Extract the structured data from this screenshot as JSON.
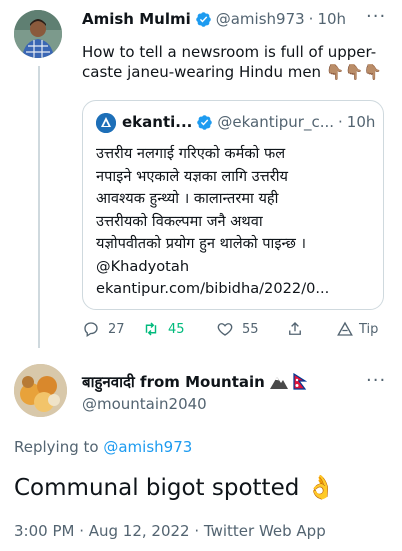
{
  "tweet": {
    "display_name": "Amish Mulmi",
    "handle": "@amish973",
    "time": "10h",
    "more": "···",
    "text_line1": "How to tell a newsroom is full of upper-",
    "text_line2": "caste janeu-wearing Hindu men",
    "emoji": "👇🏽👇🏽👇🏽",
    "quote": {
      "name": "ekanti...",
      "handle": "@ekantipur_c...",
      "time": "10h",
      "lines": [
        "उत्तरीय नलगाई गरिएको कर्मको फल",
        "नपाइने भएकाले यज्ञका लागि उत्तरीय",
        "आवश्यक हुन्थ्यो । कालान्तरमा यही",
        "उत्तरीयको विकल्पमा जनै अथवा",
        "यज्ञोपवीतको प्रयोग हुन थालेको पाइन्छ ।",
        "@Khadyotah",
        "ekantipur.com/bibidha/2022/0..."
      ]
    },
    "actions": {
      "reply_count": "27",
      "retweet_count": "45",
      "like_count": "55",
      "tip_label": "Tip"
    }
  },
  "reply": {
    "display_name": "बाहुनवादी from Mountain",
    "handle": "@mountain2040",
    "more": "···",
    "replying_prefix": "Replying to",
    "replying_handle": "@amish973",
    "text": "Communal bigot spotted",
    "emoji": "👌",
    "meta": "3:00 PM · Aug 12, 2022 · Twitter Web App"
  },
  "colors": {
    "accent": "#1d9bf0",
    "retweet_green": "#00ba7c",
    "muted": "#536471",
    "border": "#cfd9de"
  }
}
